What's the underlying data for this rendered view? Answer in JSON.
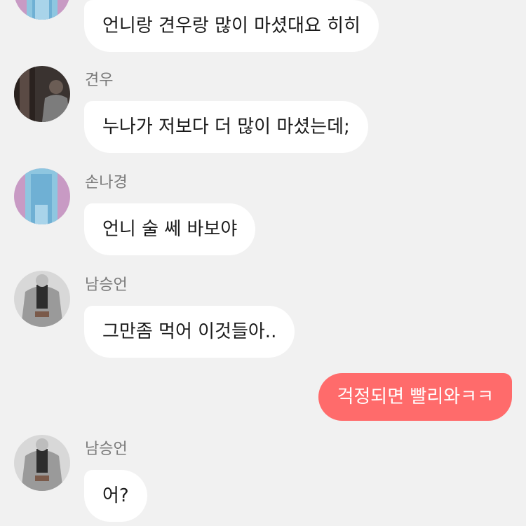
{
  "colors": {
    "background": "#f1f1f1",
    "incoming_bubble": "#ffffff",
    "outgoing_bubble": "#ff6b6b",
    "sender_name": "#7a7a7a"
  },
  "messages": [
    {
      "direction": "incoming",
      "sender": "",
      "avatar": "pink-profile-photo",
      "text": "언니랑 견우랑 많이 마셨대요 히히"
    },
    {
      "direction": "incoming",
      "sender": "견우",
      "avatar": "dark-profile-photo",
      "text": "누나가 저보다 더 많이 마셨는데;"
    },
    {
      "direction": "incoming",
      "sender": "손나경",
      "avatar": "pink-profile-photo",
      "text": "언니 술 쎄 바보야"
    },
    {
      "direction": "incoming",
      "sender": "남승언",
      "avatar": "gray-jacket-profile-photo",
      "text": "그만좀 먹어 이것들아.."
    },
    {
      "direction": "outgoing",
      "sender": "",
      "avatar": "",
      "text": "걱정되면 빨리와ㅋㅋ"
    },
    {
      "direction": "incoming",
      "sender": "남승언",
      "avatar": "gray-jacket-profile-photo",
      "text": "어?"
    }
  ]
}
